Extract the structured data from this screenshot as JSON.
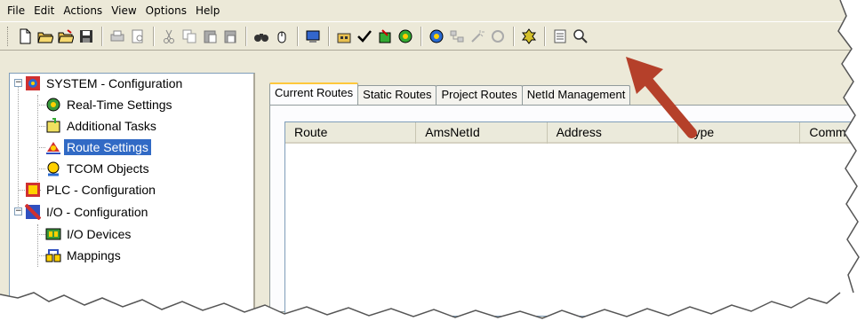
{
  "menubar": {
    "items": [
      "File",
      "Edit",
      "Actions",
      "View",
      "Options",
      "Help"
    ]
  },
  "toolbar": {
    "icons": [
      "new-file-icon",
      "open-folder-icon",
      "open-folder-alt-icon",
      "save-icon",
      "print-icon",
      "print-preview-icon",
      "cut-icon",
      "copy-icon",
      "paste-icon",
      "paste-alt-icon",
      "find-icon",
      "mouse-icon",
      "monitor-icon",
      "build-icon",
      "check-icon",
      "activate-config-icon",
      "restart-run-icon",
      "choose-target-icon",
      "network-icon",
      "wand-icon",
      "stop-icon",
      "settings-icon",
      "list-icon",
      "zoom-icon"
    ]
  },
  "tree": {
    "items": [
      {
        "label": "SYSTEM - Configuration",
        "icon": "system-config-icon",
        "level": 0,
        "expanded": true
      },
      {
        "label": "Real-Time Settings",
        "icon": "realtime-icon",
        "level": 1
      },
      {
        "label": "Additional Tasks",
        "icon": "tasks-icon",
        "level": 1
      },
      {
        "label": "Route Settings",
        "icon": "route-icon",
        "level": 1,
        "selected": true
      },
      {
        "label": "TCOM Objects",
        "icon": "tcom-icon",
        "level": 1
      },
      {
        "label": "PLC - Configuration",
        "icon": "plc-config-icon",
        "level": 0
      },
      {
        "label": "I/O - Configuration",
        "icon": "io-config-icon",
        "level": 0,
        "expanded": true
      },
      {
        "label": "I/O Devices",
        "icon": "io-devices-icon",
        "level": 1
      },
      {
        "label": "Mappings",
        "icon": "mappings-icon",
        "level": 1
      }
    ]
  },
  "tabs": [
    "Current Routes",
    "Static Routes",
    "Project Routes",
    "NetId Management"
  ],
  "table": {
    "columns": [
      "Route",
      "AmsNetId",
      "Address",
      "Type",
      "Comment"
    ]
  },
  "colors": {
    "selection": "#316ac5",
    "arrow": "#b5402a",
    "tab_highlight": "#ffc83c"
  }
}
